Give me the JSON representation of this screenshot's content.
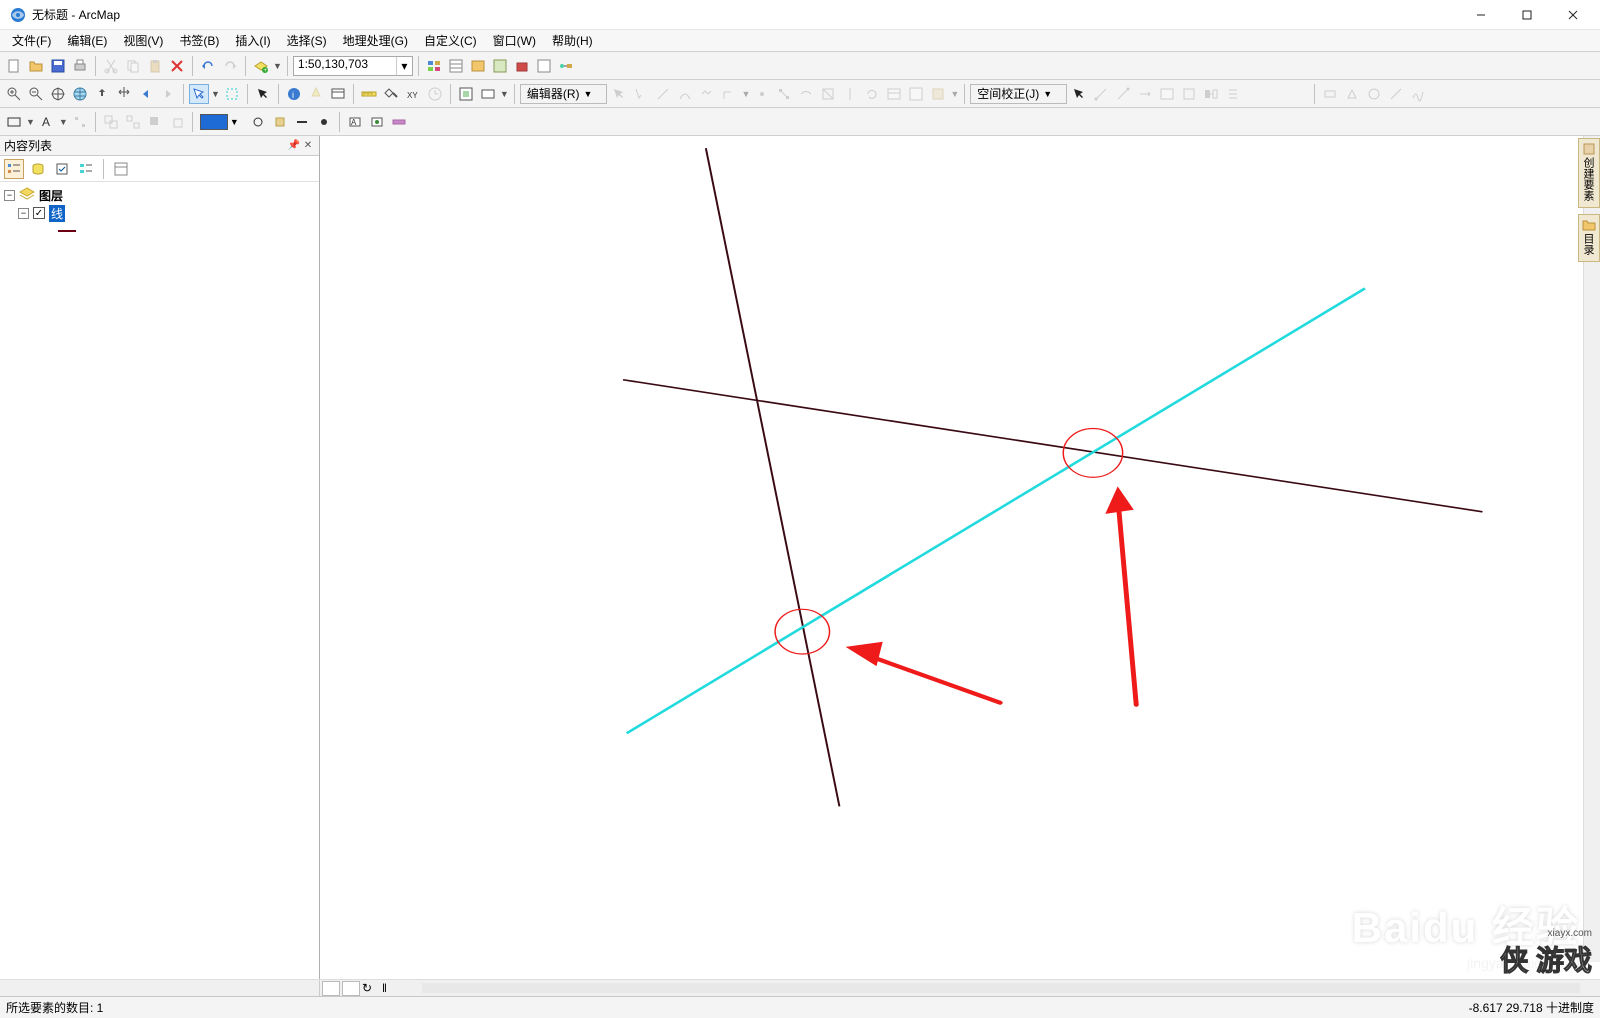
{
  "title": "无标题 - ArcMap",
  "menu": {
    "file": "文件(F)",
    "edit": "编辑(E)",
    "view": "视图(V)",
    "bookmarks": "书签(B)",
    "insert": "插入(I)",
    "selection": "选择(S)",
    "geoprocessing": "地理处理(G)",
    "customize": "自定义(C)",
    "windows": "窗口(W)",
    "help": "帮助(H)"
  },
  "toolbar": {
    "scale": "1:50,130,703",
    "editor_label": "编辑器(R)",
    "spatial_adjust_label": "空间校正(J)"
  },
  "toc": {
    "title": "内容列表",
    "root_label": "图层",
    "layer_label": "线"
  },
  "right_tabs": {
    "create_features": "创建要素",
    "catalog": "目录"
  },
  "statusbar": {
    "left": "所选要素的数目: 1",
    "coords": "-8.617 29.718 十进制度"
  },
  "watermark": {
    "text": "Baidu 经验",
    "sub": "jingyan.baidu.com"
  },
  "watermark2": {
    "text": "侠 游戏",
    "url": "xiayx.com"
  },
  "colors": {
    "line_dark": "#3a0a14",
    "line_cyan": "#22dadd",
    "annotation_red": "#ef1b1b"
  }
}
